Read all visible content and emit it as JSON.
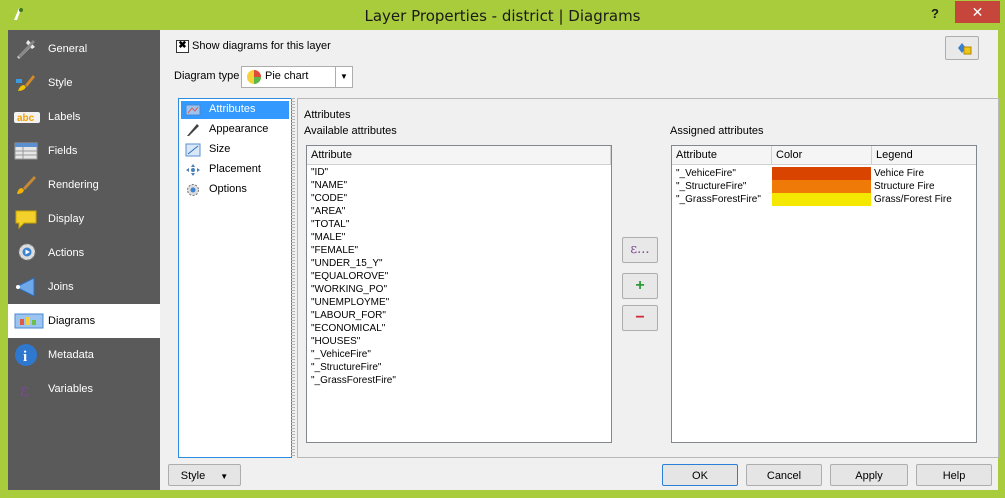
{
  "window": {
    "title": "Layer Properties - district | Diagrams",
    "help_label": "?",
    "close_label": "✕"
  },
  "sidebar": {
    "items": [
      {
        "label": "General",
        "icon": "wrench-icon"
      },
      {
        "label": "Style",
        "icon": "brush-icon"
      },
      {
        "label": "Labels",
        "icon": "abc-label-icon",
        "badge": "abc"
      },
      {
        "label": "Fields",
        "icon": "table-icon"
      },
      {
        "label": "Rendering",
        "icon": "paintbrush-icon"
      },
      {
        "label": "Display",
        "icon": "speech-bubble-icon"
      },
      {
        "label": "Actions",
        "icon": "gear-run-icon"
      },
      {
        "label": "Joins",
        "icon": "join-arrow-icon"
      },
      {
        "label": "Diagrams",
        "icon": "diagram-icon",
        "selected": true
      },
      {
        "label": "Metadata",
        "icon": "info-icon"
      },
      {
        "label": "Variables",
        "icon": "epsilon-icon"
      }
    ]
  },
  "show_diagrams": {
    "label": "Show diagrams for this layer",
    "checked": true,
    "mark": "✖"
  },
  "diagram_type": {
    "label": "Diagram type",
    "value": "Pie chart"
  },
  "tabs": [
    {
      "label": "Attributes",
      "active": true,
      "icon": "attributes-icon"
    },
    {
      "label": "Appearance",
      "icon": "pen-icon"
    },
    {
      "label": "Size",
      "icon": "size-icon"
    },
    {
      "label": "Placement",
      "icon": "placement-icon"
    },
    {
      "label": "Options",
      "icon": "options-icon"
    }
  ],
  "attributes_panel": {
    "section_title": "Attributes",
    "available_title": "Available attributes",
    "assigned_title": "Assigned attributes",
    "available_header": "Attribute",
    "available": [
      "\"ID\"",
      "\"NAME\"",
      "\"CODE\"",
      "\"AREA\"",
      "\"TOTAL\"",
      "\"MALE\"",
      "\"FEMALE\"",
      "\"UNDER_15_Y\"",
      "\"EQUALOROVE\"",
      "\"WORKING_PO\"",
      "\"UNEMPLOYME\"",
      "\"LABOUR_FOR\"",
      "\"ECONOMICAL\"",
      "\"HOUSES\"",
      "\"_VehiceFire\"",
      "\"_StructureFire\"",
      "\"_GrassForestFire\""
    ],
    "assigned_headers": [
      "Attribute",
      "Color",
      "Legend"
    ],
    "assigned": [
      {
        "attribute": "\"_VehiceFire\"",
        "color": "#d94400",
        "legend": "Vehice Fire"
      },
      {
        "attribute": "\"_StructureFire\"",
        "color": "#f07a08",
        "legend": "Structure Fire"
      },
      {
        "attribute": "\"_GrassForestFire\"",
        "color": "#f5e800",
        "legend": "Grass/Forest Fire"
      }
    ],
    "expression_button": "ε...",
    "add_button": "+",
    "remove_button": "−"
  },
  "footer": {
    "style_label": "Style",
    "ok_label": "OK",
    "cancel_label": "Cancel",
    "apply_label": "Apply",
    "help_label": "Help"
  },
  "colors": {
    "titlebar": "#a8cc3c",
    "sidebar": "#5a5a5a",
    "selection": "#3399ff"
  }
}
